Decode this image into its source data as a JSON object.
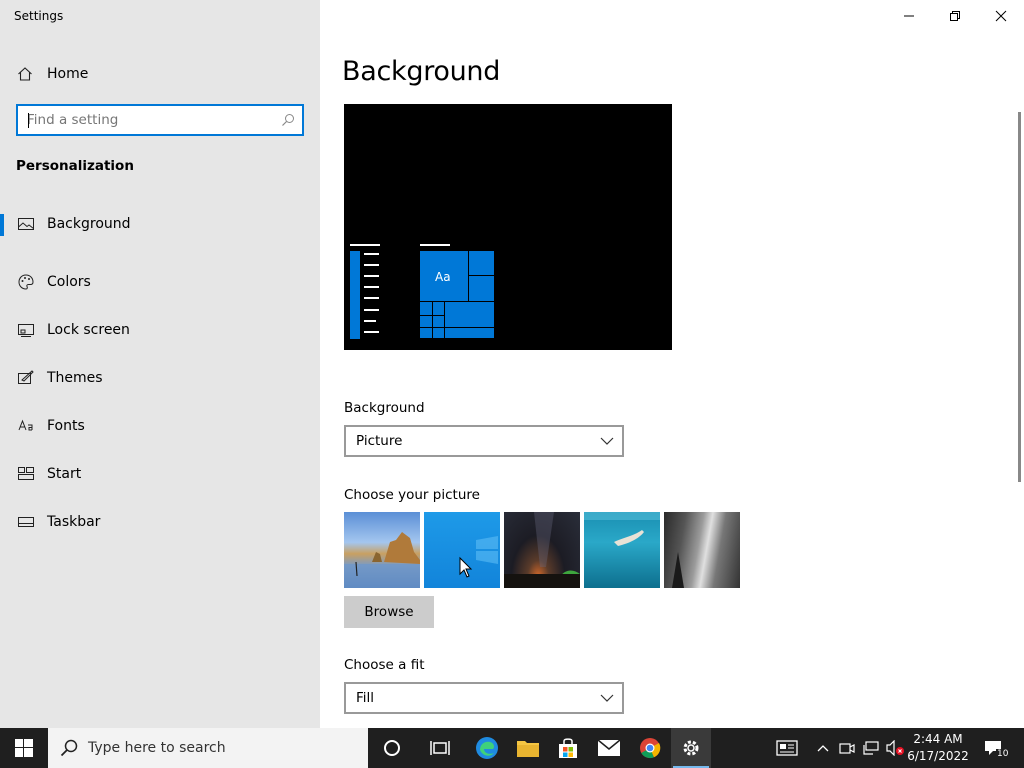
{
  "window": {
    "title": "Settings",
    "minimize_label": "Minimize",
    "restore_label": "Restore",
    "close_label": "Close"
  },
  "sidebar": {
    "home_label": "Home",
    "search_placeholder": "Find a setting",
    "section_title": "Personalization",
    "items": [
      {
        "label": "Background",
        "icon": "picture-icon",
        "selected": true
      },
      {
        "label": "Colors",
        "icon": "palette-icon",
        "selected": false
      },
      {
        "label": "Lock screen",
        "icon": "lock-screen-icon",
        "selected": false
      },
      {
        "label": "Themes",
        "icon": "themes-icon",
        "selected": false
      },
      {
        "label": "Fonts",
        "icon": "fonts-icon",
        "selected": false
      },
      {
        "label": "Start",
        "icon": "start-icon",
        "selected": false
      },
      {
        "label": "Taskbar",
        "icon": "taskbar-icon",
        "selected": false
      }
    ]
  },
  "main": {
    "title": "Background",
    "preview_tile_text": "Aa",
    "background_label": "Background",
    "background_value": "Picture",
    "choose_picture_label": "Choose your picture",
    "pictures": [
      "beach-rocks",
      "windows-blue",
      "night-sky",
      "underwater-swimmer",
      "rock-cliff"
    ],
    "browse_label": "Browse",
    "choose_fit_label": "Choose a fit",
    "fit_value": "Fill"
  },
  "taskbar": {
    "search_placeholder": "Type here to search",
    "time": "2:44 AM",
    "date": "6/17/2022",
    "notification_count": "10"
  },
  "colors": {
    "accent": "#0078d7",
    "sidebar_bg": "#e6e6e6",
    "taskbar_bg": "#1f1f1f"
  }
}
